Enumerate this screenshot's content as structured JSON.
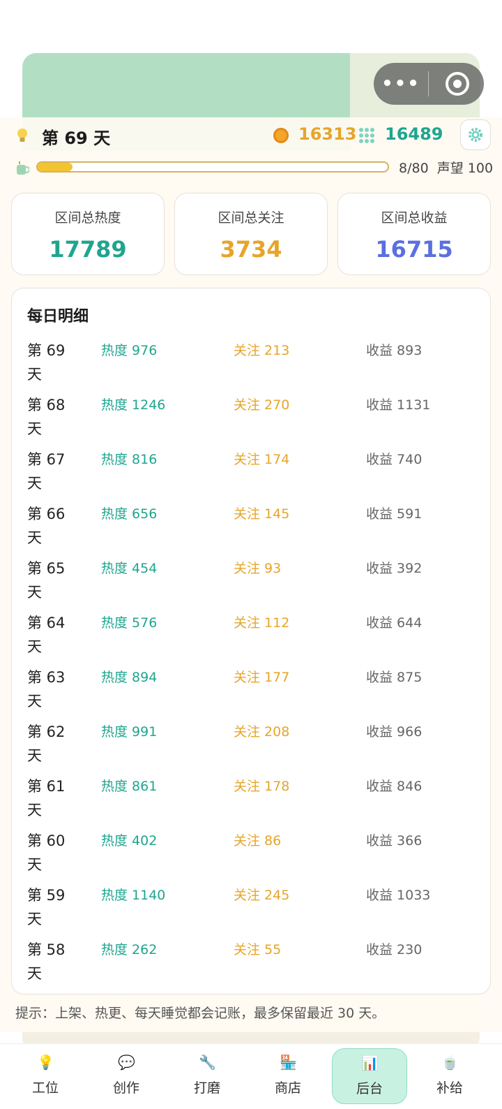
{
  "status": {
    "day_label": "第 69 天",
    "coins": "16313",
    "gems": "16489",
    "progress_text": "8/80",
    "reputation_text": "声望 100",
    "progress_fraction": 0.1
  },
  "stats": [
    {
      "label": "区间总热度",
      "value": "17789",
      "color": "#1fa58f"
    },
    {
      "label": "区间总关注",
      "value": "3734",
      "color": "#e6a52a"
    },
    {
      "label": "区间总收益",
      "value": "16715",
      "color": "#5b6fe0"
    }
  ],
  "daily": {
    "title": "每日明细",
    "rows": [
      {
        "day": "第 69 天",
        "heat": "热度 976",
        "follow": "关注 213",
        "income": "收益 893"
      },
      {
        "day": "第 68 天",
        "heat": "热度 1246",
        "follow": "关注 270",
        "income": "收益 1131"
      },
      {
        "day": "第 67 天",
        "heat": "热度 816",
        "follow": "关注 174",
        "income": "收益 740"
      },
      {
        "day": "第 66 天",
        "heat": "热度 656",
        "follow": "关注 145",
        "income": "收益 591"
      },
      {
        "day": "第 65 天",
        "heat": "热度 454",
        "follow": "关注 93",
        "income": "收益 392"
      },
      {
        "day": "第 64 天",
        "heat": "热度 576",
        "follow": "关注 112",
        "income": "收益 644"
      },
      {
        "day": "第 63 天",
        "heat": "热度 894",
        "follow": "关注 177",
        "income": "收益 875"
      },
      {
        "day": "第 62 天",
        "heat": "热度 991",
        "follow": "关注 208",
        "income": "收益 966"
      },
      {
        "day": "第 61 天",
        "heat": "热度 861",
        "follow": "关注 178",
        "income": "收益 846"
      },
      {
        "day": "第 60 天",
        "heat": "热度 402",
        "follow": "关注 86",
        "income": "收益 366"
      },
      {
        "day": "第 59 天",
        "heat": "热度 1140",
        "follow": "关注 245",
        "income": "收益 1033"
      },
      {
        "day": "第 58 天",
        "heat": "热度 262",
        "follow": "关注 55",
        "income": "收益 230"
      }
    ]
  },
  "tip": "提示：上架、热更、每天睡觉都会记账，最多保留最近 30 天。",
  "nav": [
    {
      "label": "工位",
      "icon": "bulb-icon",
      "glyph": "💡"
    },
    {
      "label": "创作",
      "icon": "chat-icon",
      "glyph": "💬"
    },
    {
      "label": "打磨",
      "icon": "wrench-icon",
      "glyph": "🔧"
    },
    {
      "label": "商店",
      "icon": "store-icon",
      "glyph": "🏪"
    },
    {
      "label": "后台",
      "icon": "chart-icon",
      "glyph": "📊",
      "active": true
    },
    {
      "label": "补给",
      "icon": "cup-icon",
      "glyph": "🍵"
    }
  ]
}
